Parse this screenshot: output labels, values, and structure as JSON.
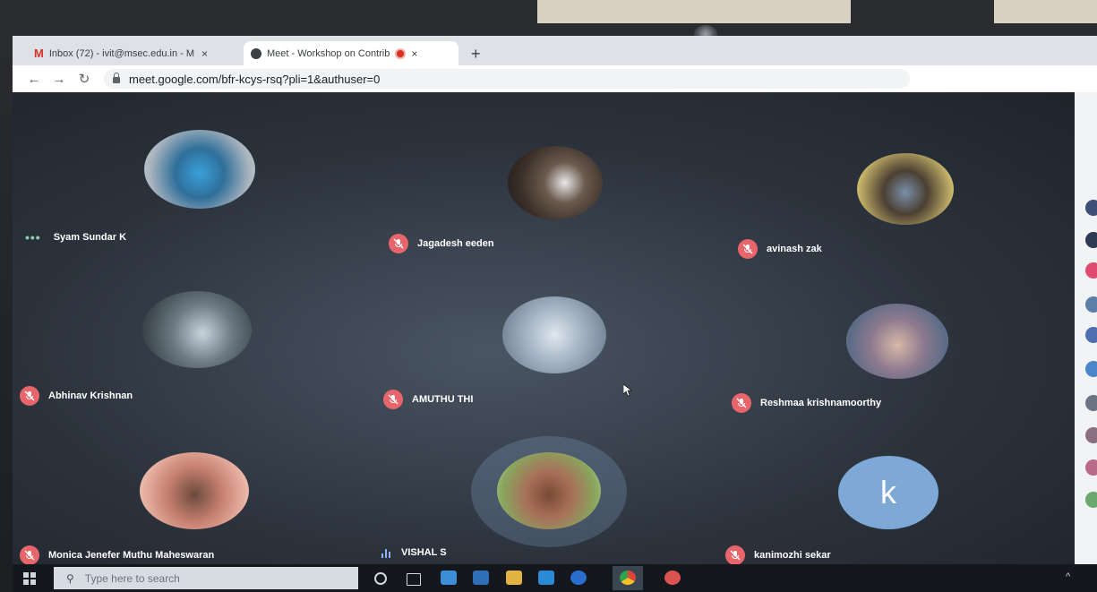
{
  "browser": {
    "tabs": [
      {
        "label": "Inbox (72) - ivit@msec.edu.in - M",
        "icon": "gmail-icon"
      },
      {
        "label": "Meet - Workshop on Contrib",
        "icon": "meet-icon"
      }
    ],
    "new_tab_symbol": "+",
    "close_symbol": "×",
    "url": "meet.google.com/bfr-kcys-rsq?pli=1&authuser=0"
  },
  "meet": {
    "participants": [
      {
        "name": "Syam Sundar K",
        "status": "speaking-dots"
      },
      {
        "name": "Jagadesh eeden",
        "status": "muted"
      },
      {
        "name": "avinash zak",
        "status": "muted"
      },
      {
        "name": "Abhinav Krishnan",
        "status": "muted"
      },
      {
        "name": "AMUTHU THI",
        "status": "muted"
      },
      {
        "name": "Reshmaa krishnamoorthy",
        "status": "muted"
      },
      {
        "name": "Monica Jenefer Muthu Maheswaran",
        "status": "muted"
      },
      {
        "name": "VISHAL S",
        "status": "speaking"
      },
      {
        "name": "kanimozhi sekar",
        "status": "muted",
        "initial": "k"
      }
    ],
    "dots_symbol": "•••"
  },
  "taskbar": {
    "search_placeholder": "Type here to search"
  }
}
